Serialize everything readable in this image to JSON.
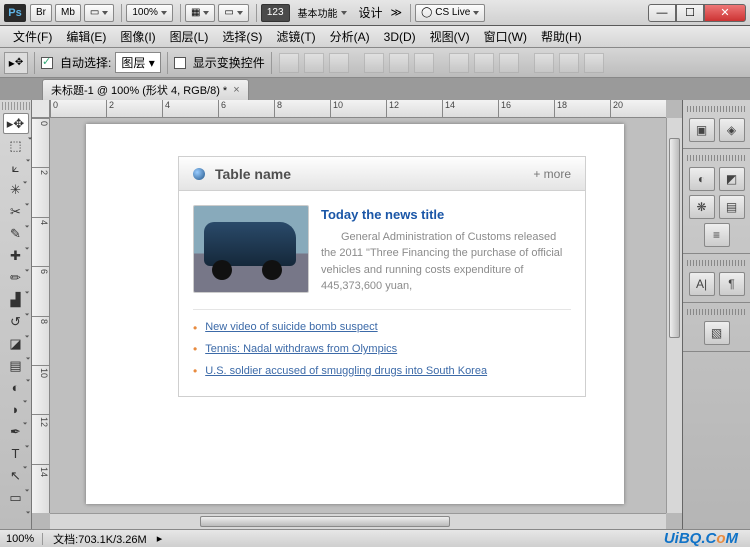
{
  "titlebar": {
    "ps": "Ps",
    "br": "Br",
    "mb": "Mb",
    "zoom": "100%",
    "btn123": "123",
    "mode_basic": "基本功能",
    "mode_design": "设计",
    "cslive": "CS Live"
  },
  "menubar": [
    "文件(F)",
    "编辑(E)",
    "图像(I)",
    "图层(L)",
    "选择(S)",
    "滤镜(T)",
    "分析(A)",
    "3D(D)",
    "视图(V)",
    "窗口(W)",
    "帮助(H)"
  ],
  "optbar": {
    "auto_select": "自动选择:",
    "layer": "图层",
    "show_transform": "显示变换控件"
  },
  "doctab": {
    "title": "未标题-1 @ 100% (形状 4, RGB/8) *"
  },
  "ruler_h": [
    "0",
    "2",
    "4",
    "6",
    "8",
    "10",
    "12",
    "14",
    "16",
    "18",
    "20"
  ],
  "ruler_v": [
    "0",
    "2",
    "4",
    "6",
    "8",
    "10",
    "12",
    "14"
  ],
  "content": {
    "table_name": "Table name",
    "more": "+ more",
    "headline": "Today the news title",
    "body": "General Administration of Customs released the 2011 \"Three Financing the purchase of official vehicles and running costs expenditure of 445,373,600 yuan,",
    "links": [
      "New video of suicide bomb suspect",
      "Tennis: Nadal withdraws from Olympics",
      "U.S. soldier accused of smuggling drugs into South Korea"
    ]
  },
  "status": {
    "zoom": "100%",
    "doc_label": "文档:",
    "doc_value": "703.1K/3.26M"
  },
  "brand": {
    "p1": "UiBQ.C",
    "p2": "o",
    "p3": "M"
  }
}
